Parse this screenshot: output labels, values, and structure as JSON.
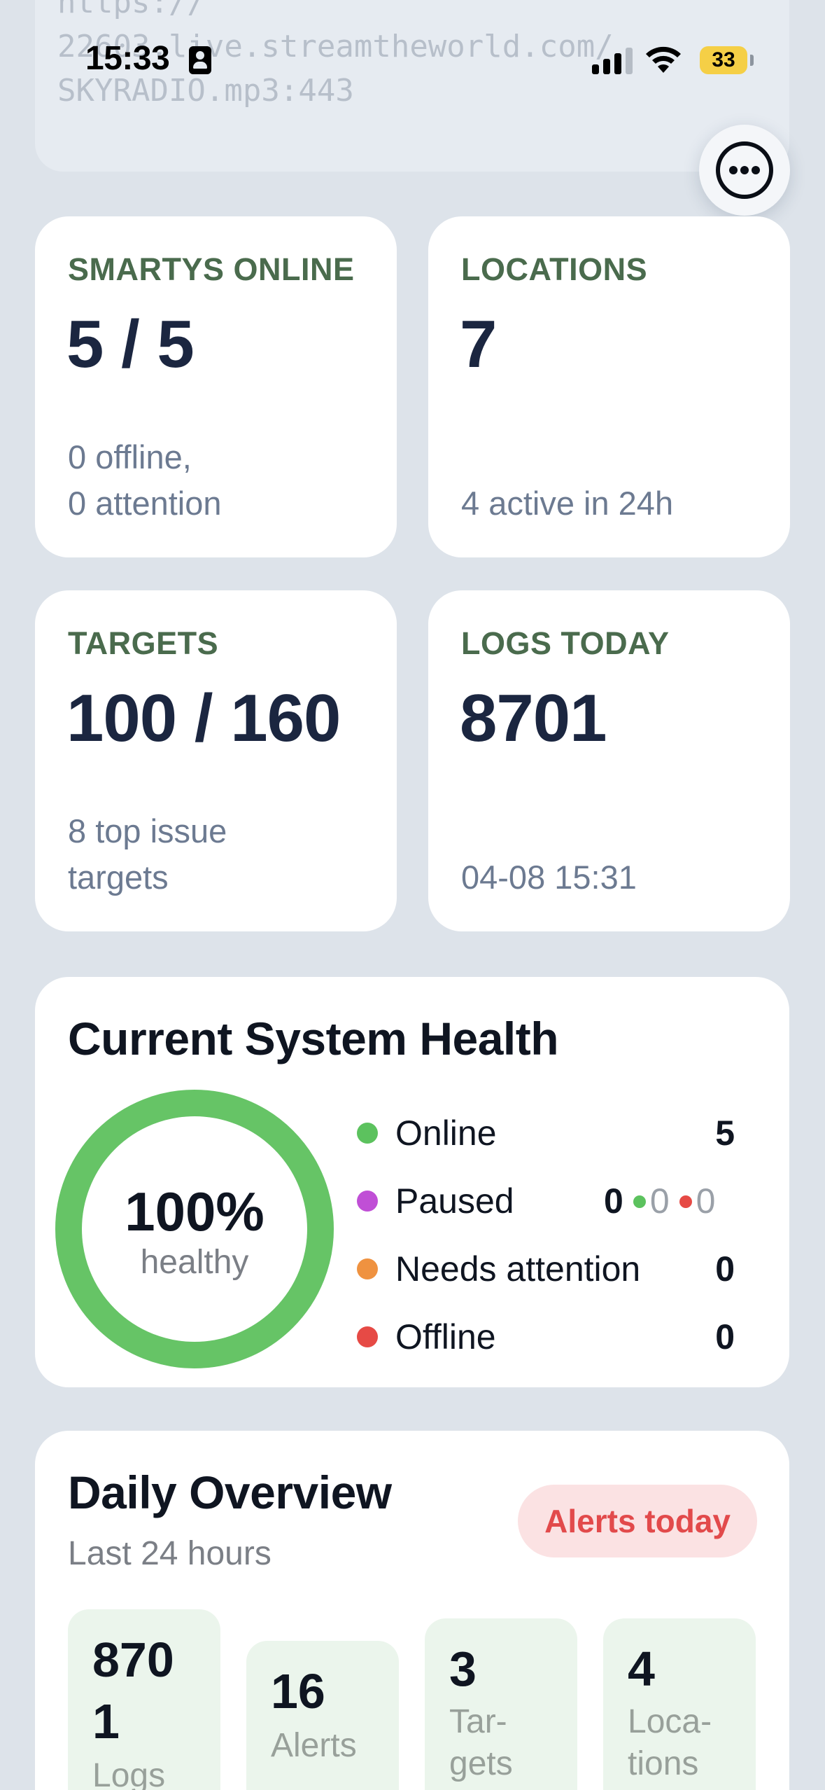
{
  "url_card": {
    "lines": [
      "https://",
      "22603.live.streamtheworld.com/",
      "SKYRADIO.mp3:443"
    ]
  },
  "status_bar": {
    "time": "15:33",
    "battery": "33"
  },
  "stats": {
    "smartys": {
      "label": "SMARTYS ONLINE",
      "value": "5 / 5",
      "sub_1": "0 offline,",
      "sub_2": "0 attention"
    },
    "locations": {
      "label": "LOCATIONS",
      "value": "7",
      "sub": "4 active in 24h"
    },
    "targets": {
      "label": "TARGETS",
      "value": "100 / 160",
      "sub_1": "8 top issue",
      "sub_2": "targets"
    },
    "logs": {
      "label": "LOGS TODAY",
      "value": "8701",
      "sub": "04-08 15:31"
    }
  },
  "health": {
    "title": "Current System Health",
    "percent": "100%",
    "percent_sub": "healthy",
    "ring_fraction": 1.0,
    "legend": [
      {
        "label": "Online",
        "value": "5",
        "color": "#5cc25e"
      },
      {
        "label": "Paused",
        "value": "0",
        "color": "#c04fd6"
      },
      {
        "label": "Needs attention",
        "value": "0",
        "color": "#ef9240"
      },
      {
        "label": "Offline",
        "value": "0",
        "color": "#e64a45"
      }
    ],
    "paused_online": "0",
    "paused_offline": "0"
  },
  "daily": {
    "title": "Daily Overview",
    "subtitle": "Last 24 hours",
    "alerts_button": "Alerts today",
    "tiles": [
      {
        "num_1": "870",
        "num_2": "1",
        "label_1": "Logs",
        "label_2": ""
      },
      {
        "num_1": "16",
        "num_2": "",
        "label_1": "Alerts",
        "label_2": ""
      },
      {
        "num_1": "3",
        "num_2": "",
        "label_1": "Tar-",
        "label_2": "gets"
      },
      {
        "num_1": "4",
        "num_2": "",
        "label_1": "Loca-",
        "label_2": "tions"
      }
    ]
  },
  "colors": {
    "background": "#dde3ea",
    "stat_label": "#4a6b4d",
    "healthy_green": "#66c466",
    "alert_red": "#e24a4b"
  }
}
